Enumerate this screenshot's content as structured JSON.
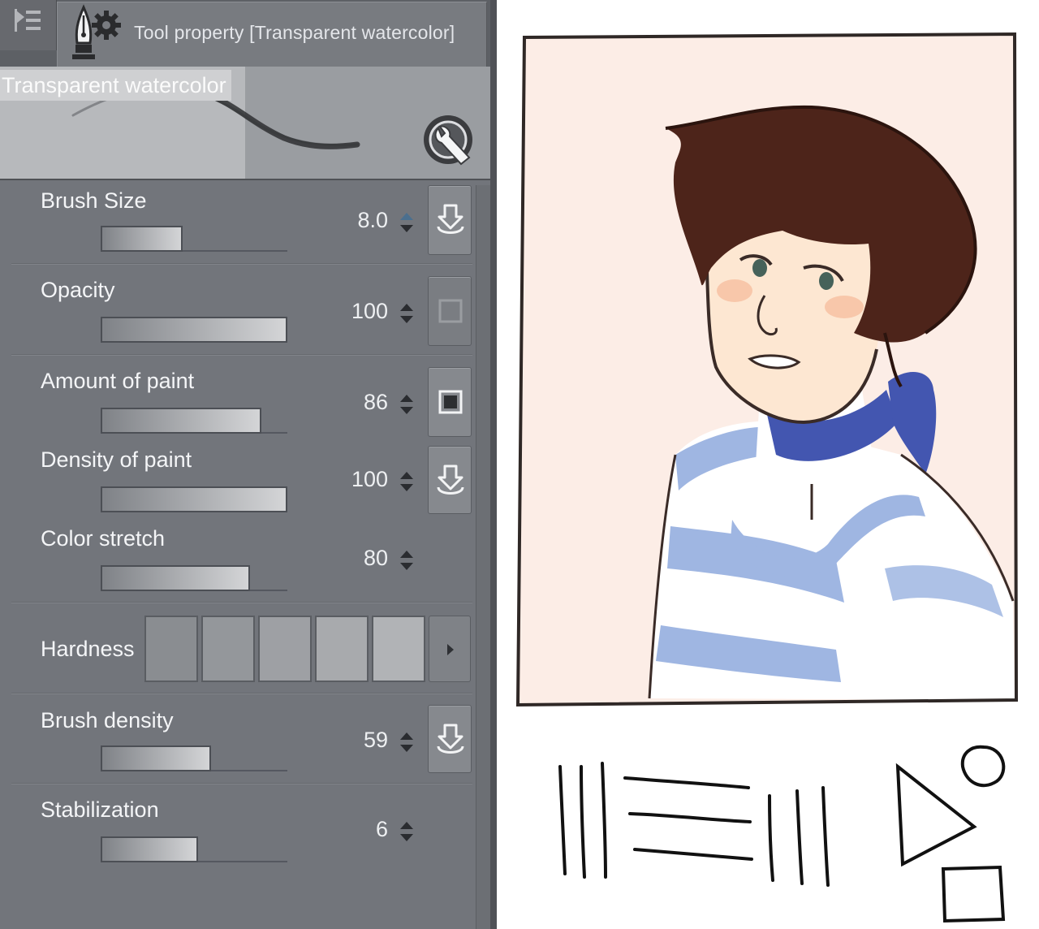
{
  "panel": {
    "tab_title": "Tool property [Transparent watercolor]",
    "preview_name": "Transparent watercolor"
  },
  "properties": [
    {
      "key": "brush_size",
      "label": "Brush Size",
      "value": "8.0",
      "level": 0.44,
      "button": "pressure"
    },
    {
      "key": "opacity",
      "label": "Opacity",
      "value": "100",
      "level": 1.0,
      "button": "checkbox-off"
    },
    {
      "key": "amount_of_paint",
      "label": "Amount of paint",
      "value": "86",
      "level": 0.86,
      "button": "checkbox-on"
    },
    {
      "key": "density_of_paint",
      "label": "Density of paint",
      "value": "100",
      "level": 1.0,
      "button": "pressure"
    },
    {
      "key": "color_stretch",
      "label": "Color stretch",
      "value": "80",
      "level": 0.8,
      "button": "none"
    },
    {
      "key": "brush_density",
      "label": "Brush density",
      "value": "59",
      "level": 0.59,
      "button": "pressure"
    },
    {
      "key": "stabilization",
      "label": "Stabilization",
      "value": "6",
      "level": 0.52,
      "button": "none"
    }
  ],
  "hardness": {
    "label": "Hardness",
    "swatches": [
      "#8a8d91",
      "#94979b",
      "#9ea0a4",
      "#a8aaad",
      "#b1b3b6"
    ]
  },
  "icons": {
    "menu": "panel-menu-icon",
    "pen": "pen-nib-icon",
    "gear": "gear-icon",
    "wrench": "wrench-settings-icon",
    "pressure": "pen-pressure-icon",
    "spin": "spin-arrows-icon",
    "next": "chevron-right-icon"
  },
  "colors": {
    "panel": "#72757b",
    "canvas_bg": "#fcede6",
    "hair": "#4d241a",
    "skin": "#fde7d2",
    "scarf": "#4356b0",
    "stripe": "#9fb6e2",
    "line": "#3a2b27"
  }
}
